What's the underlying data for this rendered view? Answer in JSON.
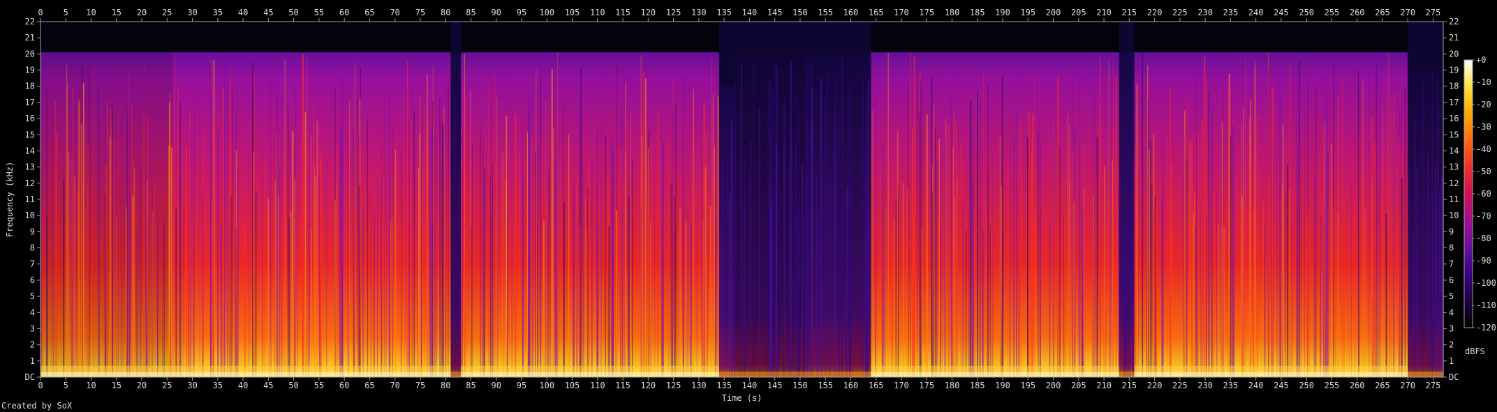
{
  "chart_data": {
    "type": "heatmap",
    "x_axis": {
      "label": "Time (s)",
      "range": [
        0,
        277
      ],
      "ticks": [
        0,
        5,
        10,
        15,
        20,
        25,
        30,
        35,
        40,
        45,
        50,
        55,
        60,
        65,
        70,
        75,
        80,
        85,
        90,
        95,
        100,
        105,
        110,
        115,
        120,
        125,
        130,
        135,
        140,
        145,
        150,
        155,
        160,
        165,
        170,
        175,
        180,
        185,
        190,
        195,
        200,
        205,
        210,
        215,
        220,
        225,
        230,
        235,
        240,
        245,
        250,
        255,
        260,
        265,
        270,
        275
      ]
    },
    "y_axis": {
      "label": "Frequency (kHz)",
      "range": [
        0,
        22
      ],
      "ticks": [
        "DC",
        "1",
        "2",
        "3",
        "4",
        "5",
        "6",
        "7",
        "8",
        "9",
        "10",
        "11",
        "12",
        "13",
        "14",
        "15",
        "16",
        "17",
        "18",
        "19",
        "20",
        "21",
        "22"
      ]
    },
    "colorbar": {
      "label": "dBFS",
      "range": [
        -120,
        0
      ],
      "ticks": [
        "+0",
        "-10",
        "-20",
        "-30",
        "-40",
        "-50",
        "-60",
        "-70",
        "-80",
        "-90",
        "-100",
        "-110",
        "-120"
      ],
      "stops": [
        "#000000",
        "#1a0040",
        "#3a0080",
        "#6a10a0",
        "#a01090",
        "#d0105a",
        "#f0302a",
        "#ff6a10",
        "#ffa800",
        "#ffe040",
        "#ffffff"
      ]
    },
    "sections": [
      {
        "start": 0,
        "end": 26,
        "intensity": 0.72,
        "cutoff_khz": 20.1
      },
      {
        "start": 26,
        "end": 81,
        "intensity": 0.9,
        "cutoff_khz": 20.1
      },
      {
        "start": 81,
        "end": 83,
        "intensity": 0.3,
        "cutoff_khz": 20.1
      },
      {
        "start": 83,
        "end": 134,
        "intensity": 0.88,
        "cutoff_khz": 20.1
      },
      {
        "start": 134,
        "end": 137,
        "intensity": 0.45,
        "cutoff_khz": 18.0
      },
      {
        "start": 137,
        "end": 151,
        "intensity": 0.22,
        "cutoff_khz": 20.0
      },
      {
        "start": 151,
        "end": 164,
        "intensity": 0.35,
        "cutoff_khz": 20.0
      },
      {
        "start": 164,
        "end": 213,
        "intensity": 0.88,
        "cutoff_khz": 20.1
      },
      {
        "start": 213,
        "end": 216,
        "intensity": 0.45,
        "cutoff_khz": 20.1
      },
      {
        "start": 216,
        "end": 270,
        "intensity": 0.88,
        "cutoff_khz": 20.1
      },
      {
        "start": 270,
        "end": 277,
        "intensity": 0.3,
        "cutoff_khz": 19.0
      }
    ]
  },
  "footer": "Created by SoX"
}
